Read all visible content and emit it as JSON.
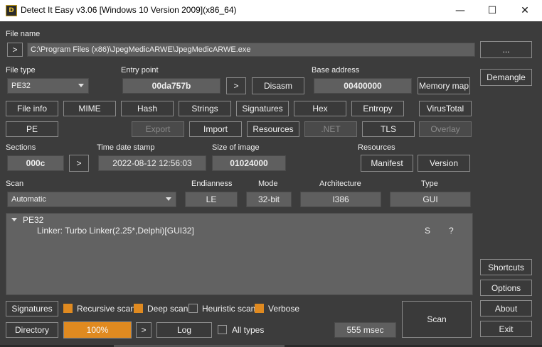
{
  "window": {
    "title": "Detect It Easy v3.06 [Windows 10 Version 2009](x86_64)",
    "minimize": "—",
    "maximize": "☐",
    "close": "✕"
  },
  "file": {
    "label": "File name",
    "path": "C:\\Program Files (x86)\\JpegMedicARWE\\JpegMedicARWE.exe",
    "browse": "...",
    "open_arrow": ">"
  },
  "filetype": {
    "label": "File type",
    "value": "PE32"
  },
  "entry": {
    "label": "Entry point",
    "value": "00da757b",
    "go": ">",
    "disasm": "Disasm"
  },
  "base": {
    "label": "Base address",
    "value": "00400000",
    "memory_map": "Memory map"
  },
  "side": {
    "demangle": "Demangle",
    "shortcuts": "Shortcuts",
    "options": "Options",
    "about": "About",
    "exit": "Exit"
  },
  "tools_row1": [
    "File info",
    "MIME",
    "Hash",
    "Strings",
    "Signatures",
    "Hex",
    "Entropy",
    "VirusTotal"
  ],
  "tools_row2": {
    "pe": "PE",
    "export": "Export",
    "import": "Import",
    "resources": "Resources",
    "net": ".NET",
    "tls": "TLS",
    "overlay": "Overlay"
  },
  "sections": {
    "label": "Sections",
    "value": "000c",
    "go": ">"
  },
  "timestamp": {
    "label": "Time date stamp",
    "value": "2022-08-12 12:56:03"
  },
  "imagesize": {
    "label": "Size of image",
    "value": "01024000"
  },
  "resources": {
    "label": "Resources",
    "manifest": "Manifest",
    "version": "Version"
  },
  "scan": {
    "label": "Scan",
    "mode_value": "Automatic",
    "endianness_label": "Endianness",
    "endianness": "LE",
    "mode_label": "Mode",
    "mode": "32-bit",
    "arch_label": "Architecture",
    "arch": "I386",
    "type_label": "Type",
    "type": "GUI"
  },
  "results": {
    "root": "PE32",
    "detections": [
      {
        "text": "Linker: Turbo Linker(2.25*,Delphi)[GUI32]",
        "s": "S",
        "q": "?"
      }
    ]
  },
  "bottom": {
    "signatures": "Signatures",
    "recursive": "Recursive scan",
    "deep": "Deep scan",
    "heuristic": "Heuristic scan",
    "verbose": "Verbose",
    "directory": "Directory",
    "progress": "100%",
    "progress_value": 1.0,
    "go": ">",
    "log": "Log",
    "alltypes": "All types",
    "time": "555 msec",
    "scan": "Scan"
  },
  "checkboxes": {
    "recursive": true,
    "deep": true,
    "heuristic": false,
    "verbose": true,
    "alltypes": false
  },
  "colors": {
    "accent": "#e08a20",
    "background": "#3c3c3c"
  }
}
